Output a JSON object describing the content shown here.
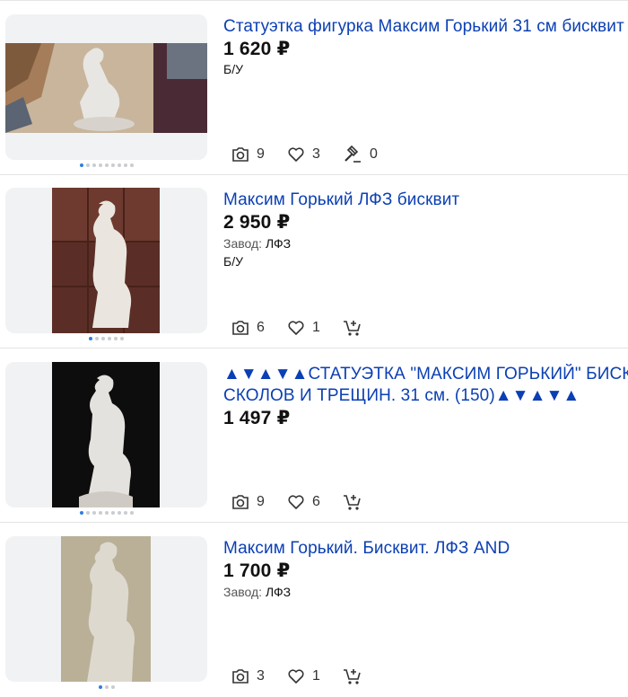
{
  "listings": [
    {
      "title": "Статуэтка фигурка Максим Горький 31 см бисквит",
      "price": "1 620 ₽",
      "attrs": [
        {
          "key": "",
          "value": "Б/У"
        }
      ],
      "photos": "9",
      "likes": "3",
      "bids": "0",
      "dots": 9,
      "active_dot": 0
    },
    {
      "title": "Максим Горький ЛФЗ бисквит",
      "price": "2 950 ₽",
      "attrs": [
        {
          "key": "Завод:",
          "value": "ЛФЗ"
        },
        {
          "key": "",
          "value": "Б/У"
        }
      ],
      "photos": "6",
      "likes": "1",
      "dots": 6,
      "active_dot": 0
    },
    {
      "title": "▲▼▲▼▲СТАТУЭТКА \"МАКСИМ ГОРЬКИЙ\" БИСКВИТ. БЕЗ СКОЛОВ И ТРЕЩИН. 31 см. (150)▲▼▲▼▲",
      "title_line1": "▲▼▲▼▲СТАТУЭТКА \"МАКСИМ ГОРЬКИЙ\" БИСКВИТ. БЕЗ",
      "title_line2": "СКОЛОВ И ТРЕЩИН. 31 см. (150)▲▼▲▼▲",
      "price": "1 497 ₽",
      "photos": "9",
      "likes": "6",
      "dots": 9,
      "active_dot": 0
    },
    {
      "title": "Максим Горький. Бисквит. ЛФЗ AND",
      "price": "1 700 ₽",
      "attrs": [
        {
          "key": "Завод:",
          "value": "ЛФЗ"
        }
      ],
      "photos": "3",
      "likes": "1",
      "dots": 3,
      "active_dot": 0
    }
  ],
  "colors": {
    "link": "#0b3fb4",
    "active_dot": "#2f7de1"
  },
  "icons": [
    "camera-icon",
    "heart-icon",
    "gavel-icon",
    "cart-plus-icon"
  ]
}
